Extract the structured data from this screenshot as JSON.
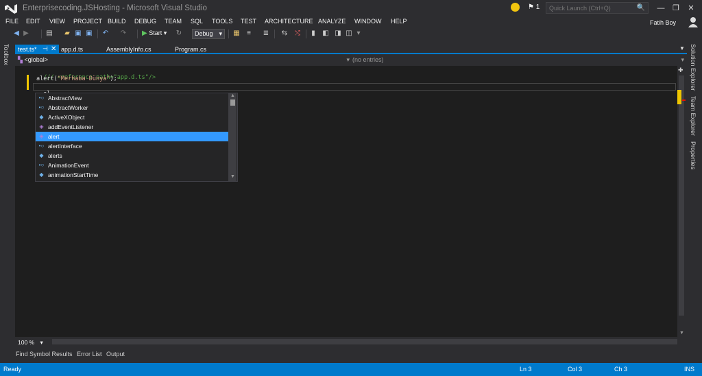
{
  "window": {
    "title": "Enterprisecoding.JSHosting - Microsoft Visual Studio",
    "logo_icon": "visual-studio-logo",
    "notification_count": "1",
    "quick_launch_placeholder": "Quick Launch (Ctrl+Q)",
    "controls": [
      "minimize",
      "restore",
      "close"
    ]
  },
  "menu": {
    "items": [
      "FILE",
      "EDIT",
      "VIEW",
      "PROJECT",
      "BUILD",
      "DEBUG",
      "TEAM",
      "SQL",
      "TOOLS",
      "TEST",
      "ARCHITECTURE",
      "ANALYZE",
      "WINDOW",
      "HELP"
    ],
    "user": "Fatih Boy"
  },
  "toolbar": {
    "start_label": "Start",
    "configuration": "Debug"
  },
  "side_panels": {
    "left": "Toolbox",
    "right": [
      "Solution Explorer",
      "Team Explorer",
      "Properties"
    ]
  },
  "tabs": [
    {
      "label": "test.ts*",
      "active": true
    },
    {
      "label": "app.d.ts",
      "active": false
    },
    {
      "label": "AssemblyInfo.cs",
      "active": false
    },
    {
      "label": "Program.cs",
      "active": false
    }
  ],
  "navbar": {
    "scope": "<global>",
    "members": "(no entries)"
  },
  "code": {
    "line1": "/// <reference path=\"app.d.ts\"/>",
    "line2_fn": "alert(",
    "line2_str": "\"Merhaba Dünya\"",
    "line2_end": ");",
    "line3": "al"
  },
  "intellisense": {
    "items": [
      {
        "label": "AbstractView",
        "icon": "interface-icon"
      },
      {
        "label": "AbstractWorker",
        "icon": "interface-icon"
      },
      {
        "label": "ActiveXObject",
        "icon": "variable-icon"
      },
      {
        "label": "addEventListener",
        "icon": "method-icon"
      },
      {
        "label": "alert",
        "icon": "method-icon",
        "selected": true
      },
      {
        "label": "alertInterface",
        "icon": "interface-icon"
      },
      {
        "label": "alerts",
        "icon": "variable-icon"
      },
      {
        "label": "AnimationEvent",
        "icon": "interface-icon"
      },
      {
        "label": "animationStartTime",
        "icon": "variable-icon"
      }
    ]
  },
  "zoom": "100 %",
  "bottom_tabs": [
    "Find Symbol Results",
    "Error List",
    "Output"
  ],
  "status": {
    "message": "Ready",
    "line": "Ln 3",
    "col": "Col 3",
    "ch": "Ch 3",
    "mode": "INS"
  },
  "colors": {
    "accent": "#007acc",
    "background": "#2d2d30",
    "editor": "#1e1e1e",
    "selection": "#3399ff",
    "comment": "#57a64a",
    "string": "#d69d85",
    "change_marker": "#efc600"
  }
}
